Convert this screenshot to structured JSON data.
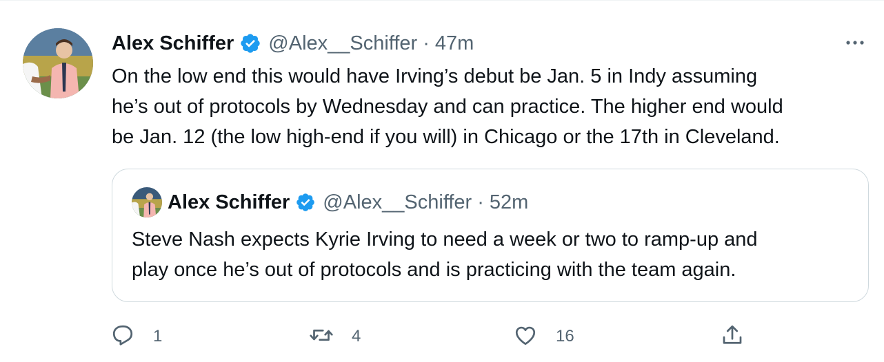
{
  "tweet": {
    "author_name": "Alex Schiffer",
    "handle": "@Alex__Schiffer",
    "separator": "·",
    "time": "47m",
    "text_lines": [
      "On the low end this would have Irving’s debut be Jan. 5 in Indy assuming",
      "he’s out of protocols by Wednesday and can practice. The higher end would",
      "be Jan. 12 (the low high-end if you will) in Chicago or the 17th in Cleveland."
    ],
    "avatar_icon": "avatar-photo",
    "verified_icon": "verified-badge-icon",
    "more_icon": "more-dots-icon"
  },
  "quote": {
    "author_name": "Alex Schiffer",
    "handle": "@Alex__Schiffer",
    "separator": "·",
    "time": "52m",
    "text_lines": [
      "Steve Nash expects Kyrie Irving to need a week or two to ramp-up and",
      "play once he’s out of protocols and is practicing with the team again."
    ]
  },
  "actions": {
    "reply_count": "1",
    "retweet_count": "4",
    "like_count": "16",
    "reply_icon": "reply-icon",
    "retweet_icon": "retweet-icon",
    "like_icon": "heart-icon",
    "share_icon": "share-icon"
  },
  "colors": {
    "text": "#0f1419",
    "secondary": "#536471",
    "verified": "#1d9bf0",
    "border": "#cfd9de"
  }
}
